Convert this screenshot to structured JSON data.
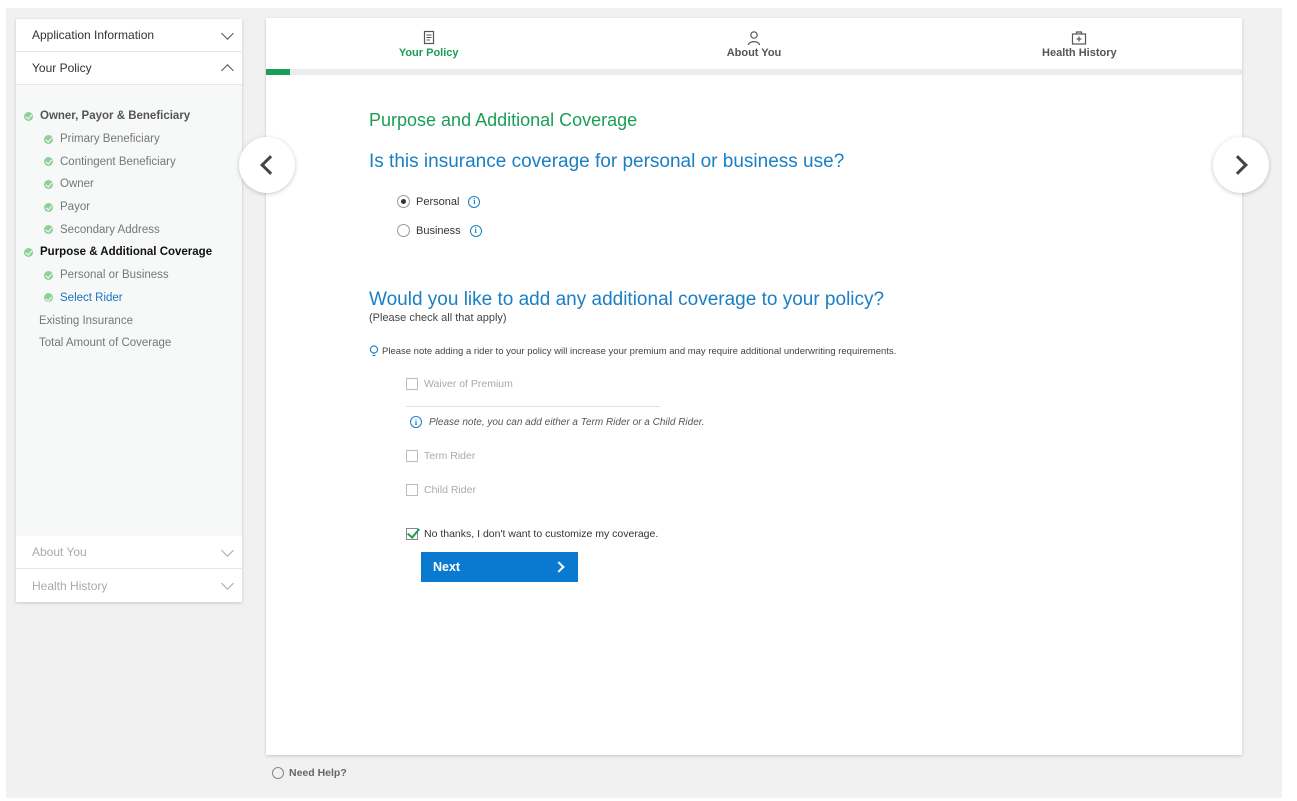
{
  "sidebar": {
    "sections": [
      {
        "label": "Application Information",
        "state": "collapsed"
      },
      {
        "label": "Your Policy",
        "state": "expanded"
      },
      {
        "label": "About You",
        "state": "collapsed"
      },
      {
        "label": "Health History",
        "state": "collapsed"
      }
    ],
    "items": [
      {
        "label": "Owner, Payor & Beneficiary"
      },
      {
        "label": "Primary Beneficiary"
      },
      {
        "label": "Contingent Beneficiary"
      },
      {
        "label": "Owner"
      },
      {
        "label": "Payor"
      },
      {
        "label": "Secondary Address"
      },
      {
        "label": "Purpose & Additional Coverage"
      },
      {
        "label": "Personal or Business"
      },
      {
        "label": "Select Rider"
      },
      {
        "label": "Existing Insurance"
      },
      {
        "label": "Total Amount of Coverage"
      }
    ]
  },
  "tabs": [
    {
      "label": "Your Policy",
      "icon": "document-icon"
    },
    {
      "label": "About You",
      "icon": "person-icon"
    },
    {
      "label": "Health History",
      "icon": "medical-kit-icon"
    }
  ],
  "progress_percent": 2.5,
  "main": {
    "section_title": "Purpose and Additional Coverage",
    "question1": "Is this insurance coverage for personal or business use?",
    "options": [
      {
        "label": "Personal",
        "selected": true
      },
      {
        "label": "Business",
        "selected": false
      }
    ],
    "question2": "Would you like to add any additional coverage to your policy?",
    "hint": "(Please check all that apply)",
    "rider_note": "Please note adding a rider to your policy will increase your premium and may require additional underwriting requirements.",
    "checkboxes": [
      {
        "label": "Waiver of Premium",
        "checked": false
      },
      {
        "label": "Term Rider",
        "checked": false
      },
      {
        "label": "Child Rider",
        "checked": false
      },
      {
        "label": "No thanks, I don't want to customize my coverage.",
        "checked": true
      }
    ],
    "either_note": "Please note, you can add either a Term Rider or a  Child Rider.",
    "next_label": "Next"
  },
  "help_label": "Need Help?",
  "colors": {
    "accent_green": "#1a9e56",
    "accent_blue": "#1a7fc4",
    "button_blue": "#0a7ad0"
  }
}
